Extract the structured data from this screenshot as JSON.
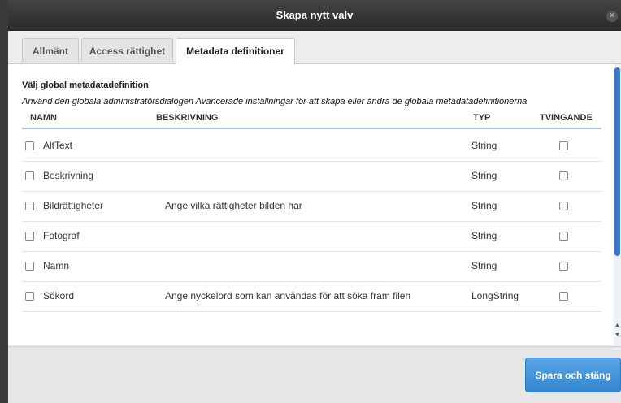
{
  "dialog": {
    "title": "Skapa nytt valv",
    "close_glyph": "×"
  },
  "tabs": [
    {
      "label": "Allmänt",
      "active": false
    },
    {
      "label": "Access rättighet",
      "active": false
    },
    {
      "label": "Metadata definitioner",
      "active": true
    }
  ],
  "section": {
    "title": "Välj global metadatadefinition",
    "hint": "Använd den globala administratörsdialogen Avancerade inställningar för att skapa eller ändra de globala metadatadefinitionerna"
  },
  "table": {
    "headers": {
      "name": "NAMN",
      "description": "BESKRIVNING",
      "type": "TYP",
      "required": "TVINGANDE"
    },
    "rows": [
      {
        "name": "AltText",
        "description": "",
        "type": "String",
        "selected": false,
        "required": false
      },
      {
        "name": "Beskrivning",
        "description": "",
        "type": "String",
        "selected": false,
        "required": false
      },
      {
        "name": "Bildrättigheter",
        "description": "Ange vilka rättigheter bilden har",
        "type": "String",
        "selected": false,
        "required": false
      },
      {
        "name": "Fotograf",
        "description": "",
        "type": "String",
        "selected": false,
        "required": false
      },
      {
        "name": "Namn",
        "description": "",
        "type": "String",
        "selected": false,
        "required": false
      },
      {
        "name": "Sökord",
        "description": "Ange nyckelord som kan användas för att söka fram filen",
        "type": "LongString",
        "selected": false,
        "required": false
      }
    ]
  },
  "footer": {
    "save_label": "Spara och stäng"
  },
  "colors": {
    "accent": "#3b8bd6",
    "titlebar": "#333333"
  }
}
